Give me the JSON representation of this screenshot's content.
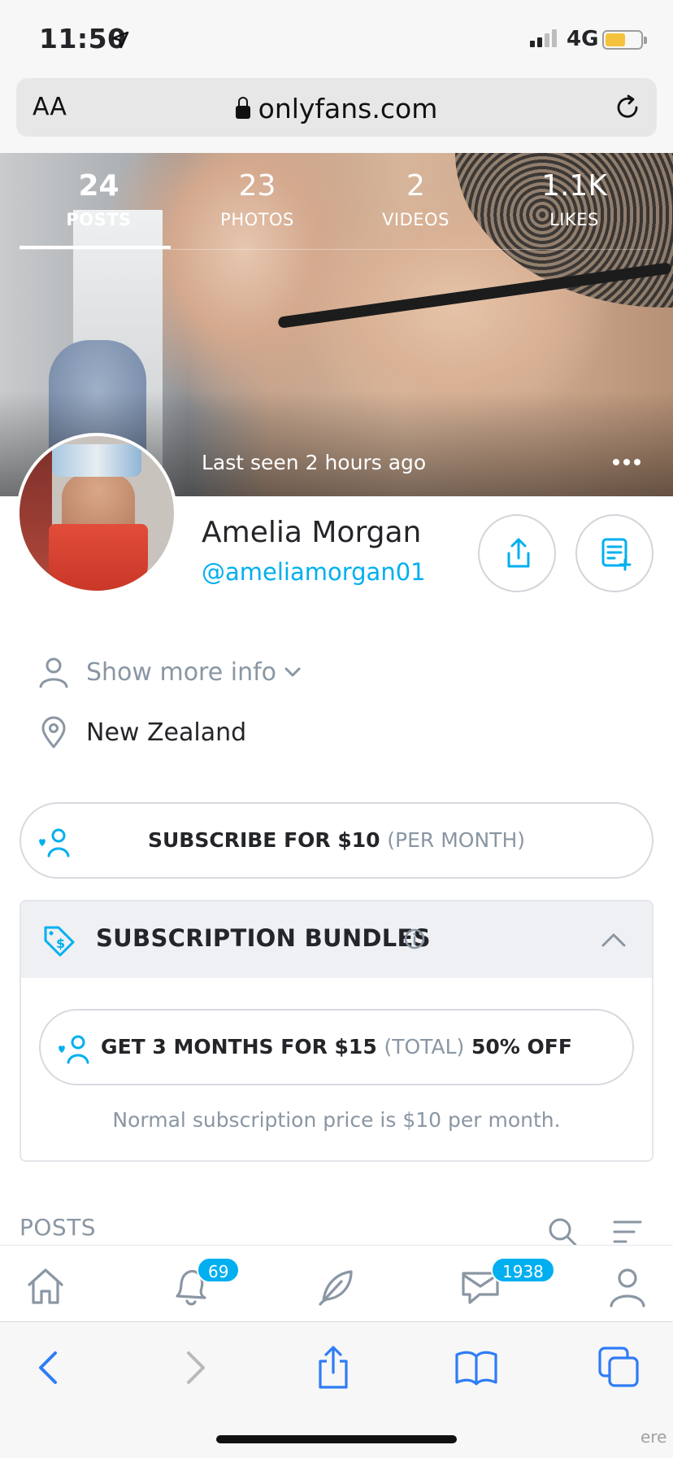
{
  "status_bar": {
    "time": "11:50",
    "network": "4G"
  },
  "browser": {
    "text_size_label": "AA",
    "url": "onlyfans.com"
  },
  "profile": {
    "stats": [
      {
        "value": "24",
        "label": "POSTS",
        "active": true
      },
      {
        "value": "23",
        "label": "PHOTOS",
        "active": false
      },
      {
        "value": "2",
        "label": "VIDEOS",
        "active": false
      },
      {
        "value": "1.1K",
        "label": "LIKES",
        "active": false
      }
    ],
    "last_seen": "Last seen 2 hours ago",
    "name": "Amelia Morgan",
    "handle": "@ameliamorgan01",
    "show_more": "Show more info",
    "location": "New Zealand"
  },
  "subscribe": {
    "label": "SUBSCRIBE FOR $10",
    "period": "(PER MONTH)"
  },
  "bundles": {
    "title": "SUBSCRIPTION BUNDLES",
    "offer_main": "GET 3 MONTHS FOR $15",
    "offer_total": "(TOTAL)",
    "offer_discount": "50% OFF",
    "normal_price_note": "Normal subscription price is $10 per month."
  },
  "posts": {
    "header": "POSTS"
  },
  "bottom_nav": {
    "notifications_badge": "69",
    "messages_badge": "1938"
  },
  "corner_text": "ere",
  "colors": {
    "accent": "#00aff0",
    "muted": "#8a96a3",
    "text": "#242529"
  },
  "icons": {
    "nav": [
      "home-icon",
      "bell-icon",
      "feather-icon",
      "messages-icon",
      "user-icon"
    ],
    "safari": [
      "back-icon",
      "forward-icon",
      "share-icon",
      "bookmarks-icon",
      "tabs-icon"
    ]
  }
}
